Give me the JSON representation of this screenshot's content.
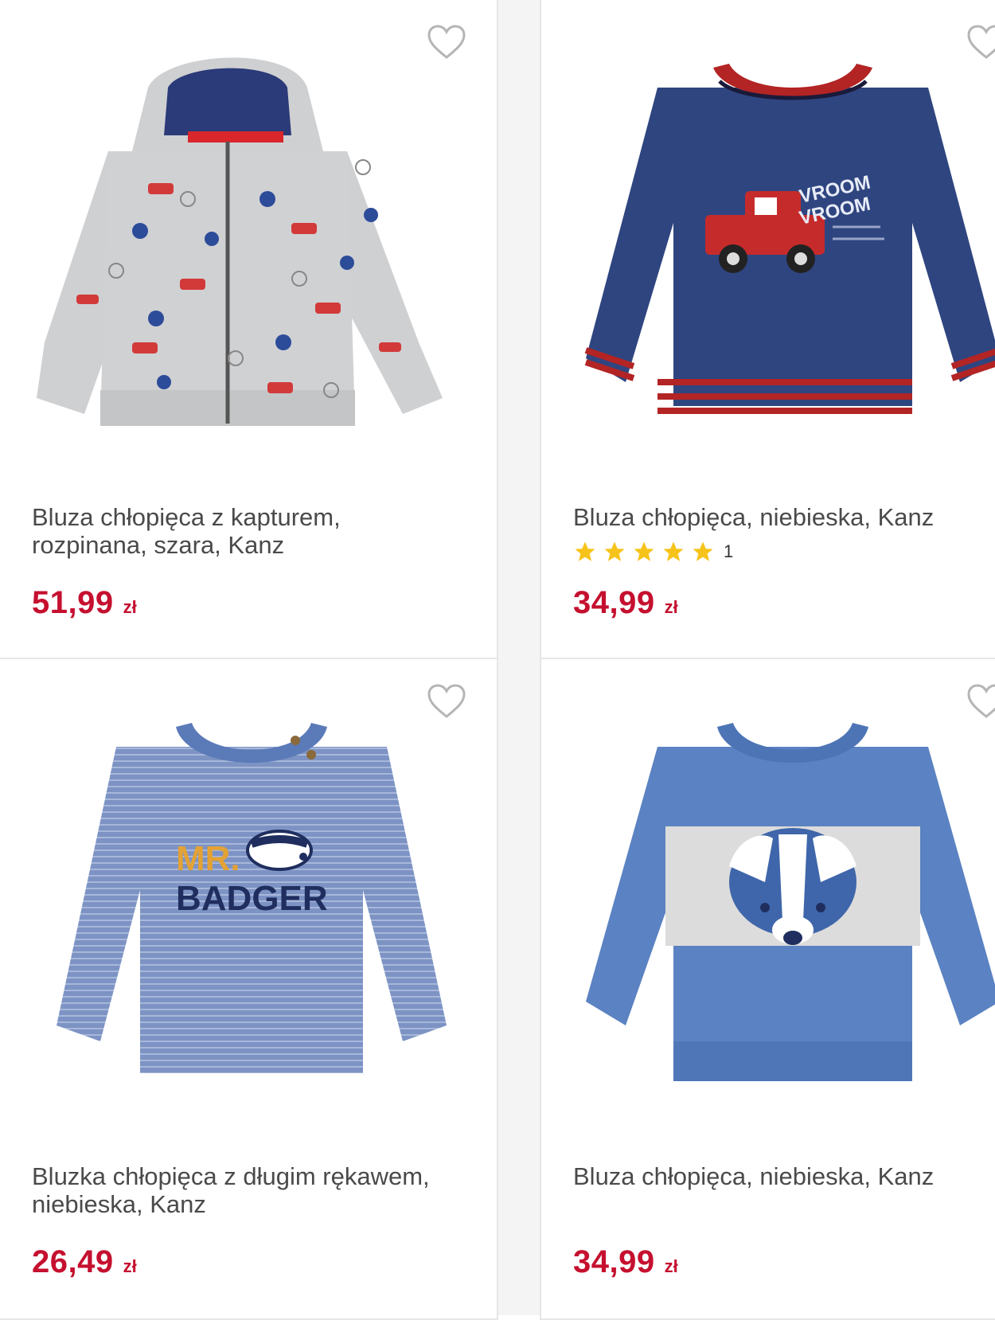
{
  "products": [
    {
      "title": "Bluza chłopięca z kapturem, rozpinana, szara, Kanz",
      "price": "51,99",
      "currency": "zł",
      "image": "grey-zip-hoodie-cars-print",
      "favorite": false
    },
    {
      "title": "Bluza chłopięca, niebieska, Kanz",
      "price": "34,99",
      "currency": "zł",
      "rating_stars": 5,
      "rating_count": "1",
      "image": "navy-sweatshirt-red-truck-vroom-vroom",
      "favorite": false
    },
    {
      "title": "Bluzka chłopięca z długim rękawem, niebieska, Kanz",
      "price": "26,49",
      "currency": "zł",
      "image": "blue-striped-longsleeve-mr-badger",
      "favorite": false
    },
    {
      "title": "Bluza chłopięca, niebieska, Kanz",
      "price": "34,99",
      "currency": "zł",
      "image": "blue-sweatshirt-badger-face",
      "favorite": false
    }
  ],
  "colors": {
    "price": "#c5102f",
    "star": "#f6c31a",
    "heart": "#b5b5b5",
    "text": "#4a4a4a"
  }
}
